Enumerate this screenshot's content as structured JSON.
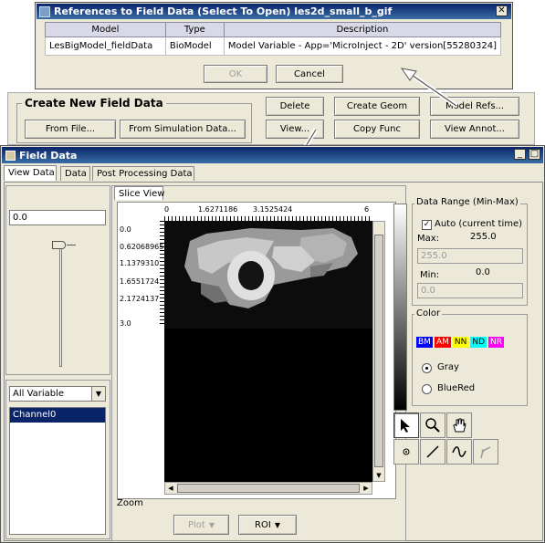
{
  "refs_window": {
    "title": "References to Field Data (Select To Open) les2d_small_b_gif",
    "columns": [
      "Model",
      "Type",
      "Description"
    ],
    "rows": [
      {
        "model": "LesBigModel_fieldData",
        "type": "BioModel",
        "description": "Model Variable - App='MicroInject - 2D' version[55280324]"
      }
    ],
    "ok_label": "OK",
    "cancel_label": "Cancel",
    "close_glyph": "✕"
  },
  "create_panel": {
    "title": "Create New Field Data",
    "from_file_label": "From File...",
    "from_sim_label": "From Simulation Data...",
    "delete_label": "Delete",
    "create_geom_label": "Create Geom",
    "model_refs_label": "Model Refs...",
    "view_label": "View...",
    "copy_func_label": "Copy Func",
    "view_annot_label": "View Annot..."
  },
  "field_window": {
    "title": "Field Data",
    "tabs": [
      "View Data",
      "Data",
      "Post Processing Data"
    ],
    "slice_value": "0.0",
    "variable_select": "All Variable",
    "variables": [
      "Channel0"
    ],
    "slice_view_label": "Slice View",
    "top_ticks": [
      "0",
      "1.6271186",
      "3.1525424",
      "6"
    ],
    "left_ticks": [
      "0.0",
      "0.62068965",
      "1.1379310",
      "1.6551724",
      "2.1724137",
      "3.0"
    ],
    "zoom_label": "Zoom",
    "plot_label": "Plot",
    "roi_label": "ROI",
    "data_range": {
      "title": "Data Range (Min-Max)",
      "auto_label": "Auto (current time)",
      "auto_checked": true,
      "max_label": "Max:",
      "max_value": "255.0",
      "max_field": "255.0",
      "min_label": "Min:",
      "min_value": "0.0",
      "min_field": "0.0"
    },
    "color": {
      "title": "Color",
      "chips": [
        {
          "label": "BM",
          "bg": "#0000ff",
          "fg": "#ffffff"
        },
        {
          "label": "AM",
          "bg": "#ff0000",
          "fg": "#ffffff"
        },
        {
          "label": "NN",
          "bg": "#ffff00",
          "fg": "#000000"
        },
        {
          "label": "ND",
          "bg": "#00ffff",
          "fg": "#000000"
        },
        {
          "label": "NR",
          "bg": "#ff00ff",
          "fg": "#ffffff"
        }
      ],
      "gray_label": "Gray",
      "bluered_label": "BlueRed",
      "selected": "Gray"
    },
    "tools": [
      "pointer-icon",
      "zoom-icon",
      "hand-icon",
      "point-icon",
      "line-icon",
      "curve-icon",
      "polyline-icon"
    ]
  },
  "colors": {
    "titlebar": "#0a246a",
    "panel": "#ece9d8",
    "selection": "#0a246a"
  }
}
